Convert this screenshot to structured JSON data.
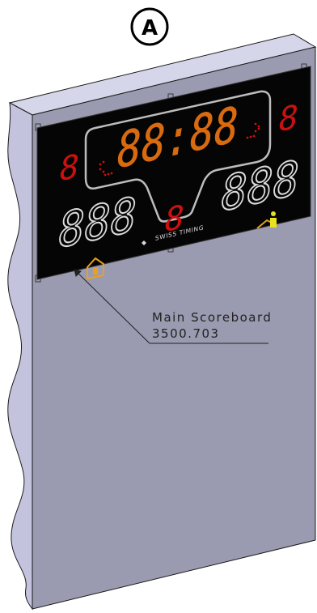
{
  "badge": {
    "letter": "A"
  },
  "callout": {
    "line1": "Main Scoreboard",
    "line2": "3500.703"
  },
  "scoreboard": {
    "brand": "SWISS TIMING",
    "clock": "88:88",
    "left_period": "8",
    "right_period": "8",
    "center_digit": "8",
    "home_score": "888",
    "guest_score": "888",
    "colors": {
      "clock": "#d86a10",
      "period": "#cc1010",
      "score": "#dcdcdc",
      "panel": "#050505",
      "icon": "#e8a020"
    },
    "icons": {
      "home": "home-icon",
      "guest": "guest-icon",
      "left_arrow": "possession-left-arrow-icon",
      "right_arrow": "possession-right-arrow-icon",
      "logo": "swiss-timing-logo-icon"
    }
  },
  "wall": {
    "colors": {
      "front": "#9a9ab0",
      "side": "#c3c3dd",
      "top": "#d6d6ea",
      "outline": "#1a1a1a"
    }
  }
}
